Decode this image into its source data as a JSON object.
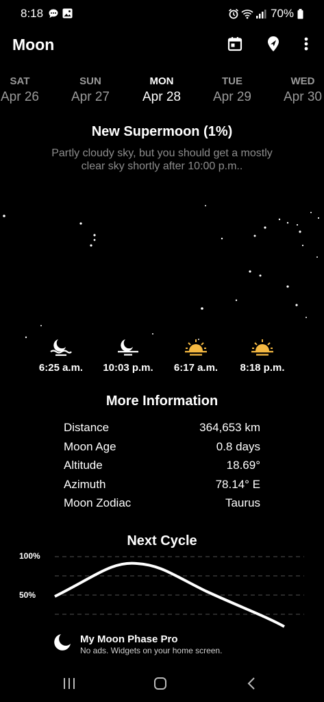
{
  "status_bar": {
    "time": "8:18",
    "battery": "70%"
  },
  "app_bar": {
    "title": "Moon",
    "icons": [
      "calendar-icon",
      "location-pin-icon",
      "more-vert-icon"
    ]
  },
  "days": [
    {
      "name": "SAT",
      "date": "Apr 26",
      "selected": false
    },
    {
      "name": "SUN",
      "date": "Apr 27",
      "selected": false
    },
    {
      "name": "MON",
      "date": "Apr 28",
      "selected": true
    },
    {
      "name": "TUE",
      "date": "Apr 29",
      "selected": false
    },
    {
      "name": "WED",
      "date": "Apr 30",
      "selected": false
    }
  ],
  "phase": {
    "title": "New Supermoon (1%)",
    "description": "Partly cloudy sky, but you should get a mostly clear sky shortly after 10:00 p.m.."
  },
  "events": [
    {
      "time": "6:25 a.m.",
      "icon": "moonrise-icon",
      "color": "#ffffff"
    },
    {
      "time": "10:03 p.m.",
      "icon": "moonset-icon",
      "color": "#ffffff"
    },
    {
      "time": "6:17 a.m.",
      "icon": "sunrise-icon",
      "color": "#f5b942"
    },
    {
      "time": "8:18 p.m.",
      "icon": "sunset-icon",
      "color": "#f5b942"
    }
  ],
  "more_info": {
    "title": "More Information",
    "rows": [
      {
        "label": "Distance",
        "value": "364,653 km"
      },
      {
        "label": "Moon Age",
        "value": "0.8 days"
      },
      {
        "label": "Altitude",
        "value": "18.69°"
      },
      {
        "label": "Azimuth",
        "value": "78.14° E"
      },
      {
        "label": "Moon Zodiac",
        "value": "Taurus"
      }
    ]
  },
  "next_cycle": {
    "title": "Next Cycle",
    "y_labels": [
      "100%",
      "50%"
    ]
  },
  "promo": {
    "title": "My Moon Phase Pro",
    "subtitle": "No ads. Widgets on your home screen."
  }
}
